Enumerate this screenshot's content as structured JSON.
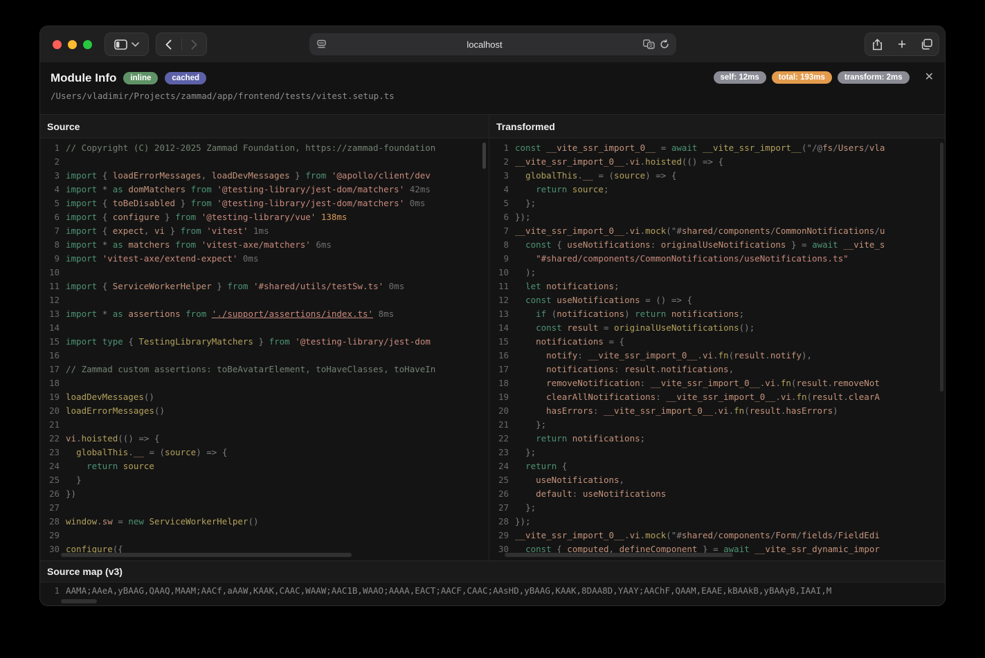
{
  "browser": {
    "url": "localhost",
    "icons": {
      "sidebar": "sidebar-toggle",
      "chevron_down": "⌄",
      "back": "‹",
      "forward": "›",
      "page_settings": "page-settings",
      "translate": "translate",
      "reload": "reload",
      "share": "share",
      "plus": "+",
      "tabs": "tab-overview"
    }
  },
  "module": {
    "title": "Module Info",
    "flags": [
      {
        "label": "inline",
        "bg": "#5f9367"
      },
      {
        "label": "cached",
        "bg": "#5c61a8"
      }
    ],
    "path": "/Users/vladimir/Projects/zammad/app/frontend/tests/vitest.setup.ts",
    "timings": [
      {
        "label": "self: 12ms",
        "bg": "#8b8b95"
      },
      {
        "label": "total: 193ms",
        "bg": "#e39c4d"
      },
      {
        "label": "transform: 2ms",
        "bg": "#8b8b95"
      }
    ],
    "close_glyph": "✕"
  },
  "source_panel": {
    "label": "Source",
    "lines": [
      "// Copyright (C) 2012-2025 Zammad Foundation, https://zammad-foundation",
      "",
      "import { loadErrorMessages, loadDevMessages } from '@apollo/client/dev",
      "import * as domMatchers from '@testing-library/jest-dom/matchers' 42ms",
      "import { toBeDisabled } from '@testing-library/jest-dom/matchers' 0ms",
      "import { configure } from '@testing-library/vue' 138ms",
      "import { expect, vi } from 'vitest' 1ms",
      "import * as matchers from 'vitest-axe/matchers' 6ms",
      "import 'vitest-axe/extend-expect' 0ms",
      "",
      "import { ServiceWorkerHelper } from '#shared/utils/testSw.ts' 0ms",
      "",
      "import * as assertions from './support/assertions/index.ts' 8ms",
      "",
      "import type { TestingLibraryMatchers } from '@testing-library/jest-dom",
      "",
      "// Zammad custom assertions: toBeAvatarElement, toHaveClasses, toHaveIn",
      "",
      "loadDevMessages()",
      "loadErrorMessages()",
      "",
      "vi.hoisted(() => {",
      "  globalThis.__ = (source) => {",
      "    return source",
      "  }",
      "})",
      "",
      "window.sw = new ServiceWorkerHelper()",
      "",
      "configure({"
    ]
  },
  "transformed_panel": {
    "label": "Transformed",
    "lines": [
      "const __vite_ssr_import_0__ = await __vite_ssr_import__(\"/@fs/Users/vla",
      "__vite_ssr_import_0__.vi.hoisted(() => {",
      "  globalThis.__ = (source) => {",
      "    return source;",
      "  };",
      "});",
      "__vite_ssr_import_0__.vi.mock(\"#shared/components/CommonNotifications/u",
      "  const { useNotifications: originalUseNotifications } = await __vite_s",
      "    \"#shared/components/CommonNotifications/useNotifications.ts\"",
      "  );",
      "  let notifications;",
      "  const useNotifications = () => {",
      "    if (notifications) return notifications;",
      "    const result = originalUseNotifications();",
      "    notifications = {",
      "      notify: __vite_ssr_import_0__.vi.fn(result.notify),",
      "      notifications: result.notifications,",
      "      removeNotification: __vite_ssr_import_0__.vi.fn(result.removeNot",
      "      clearAllNotifications: __vite_ssr_import_0__.vi.fn(result.clearA",
      "      hasErrors: __vite_ssr_import_0__.vi.fn(result.hasErrors)",
      "    };",
      "    return notifications;",
      "  };",
      "  return {",
      "    useNotifications,",
      "    default: useNotifications",
      "  };",
      "});",
      "__vite_ssr_import_0__.vi.mock(\"#shared/components/Form/fields/FieldEdi",
      "  const { computed, defineComponent } = await __vite_ssr_dynamic_impor"
    ]
  },
  "sourcemap": {
    "label": "Source map (v3)",
    "line_number": "1",
    "mapping": "AAMA;AAeA,yBAAG,QAAQ,MAAM;AACf,aAAW,KAAK,CAAC,WAAW;AAC1B,WAAO;AAAA,EACT;AACF,CAAC;AAsHD,yBAAG,KAAK,8DAA8D,YAAY;AAChF,QAAM,EAAE,kBAAkB,yBAAyB,IAAI,M"
  },
  "syntax_colors": {
    "keyword": "#4d9375",
    "string": "#c98a7d",
    "function": "#b3a15c",
    "identifier": "#c5937b",
    "comment": "#738273",
    "punctuation": "#808080",
    "timing": "#707070",
    "timing_hot": "#d7995b",
    "link_string": "./support/assertions/index.ts"
  },
  "traffic_lights": {
    "close": "#ff5f57",
    "minimize": "#febc2e",
    "zoom": "#28c840"
  }
}
